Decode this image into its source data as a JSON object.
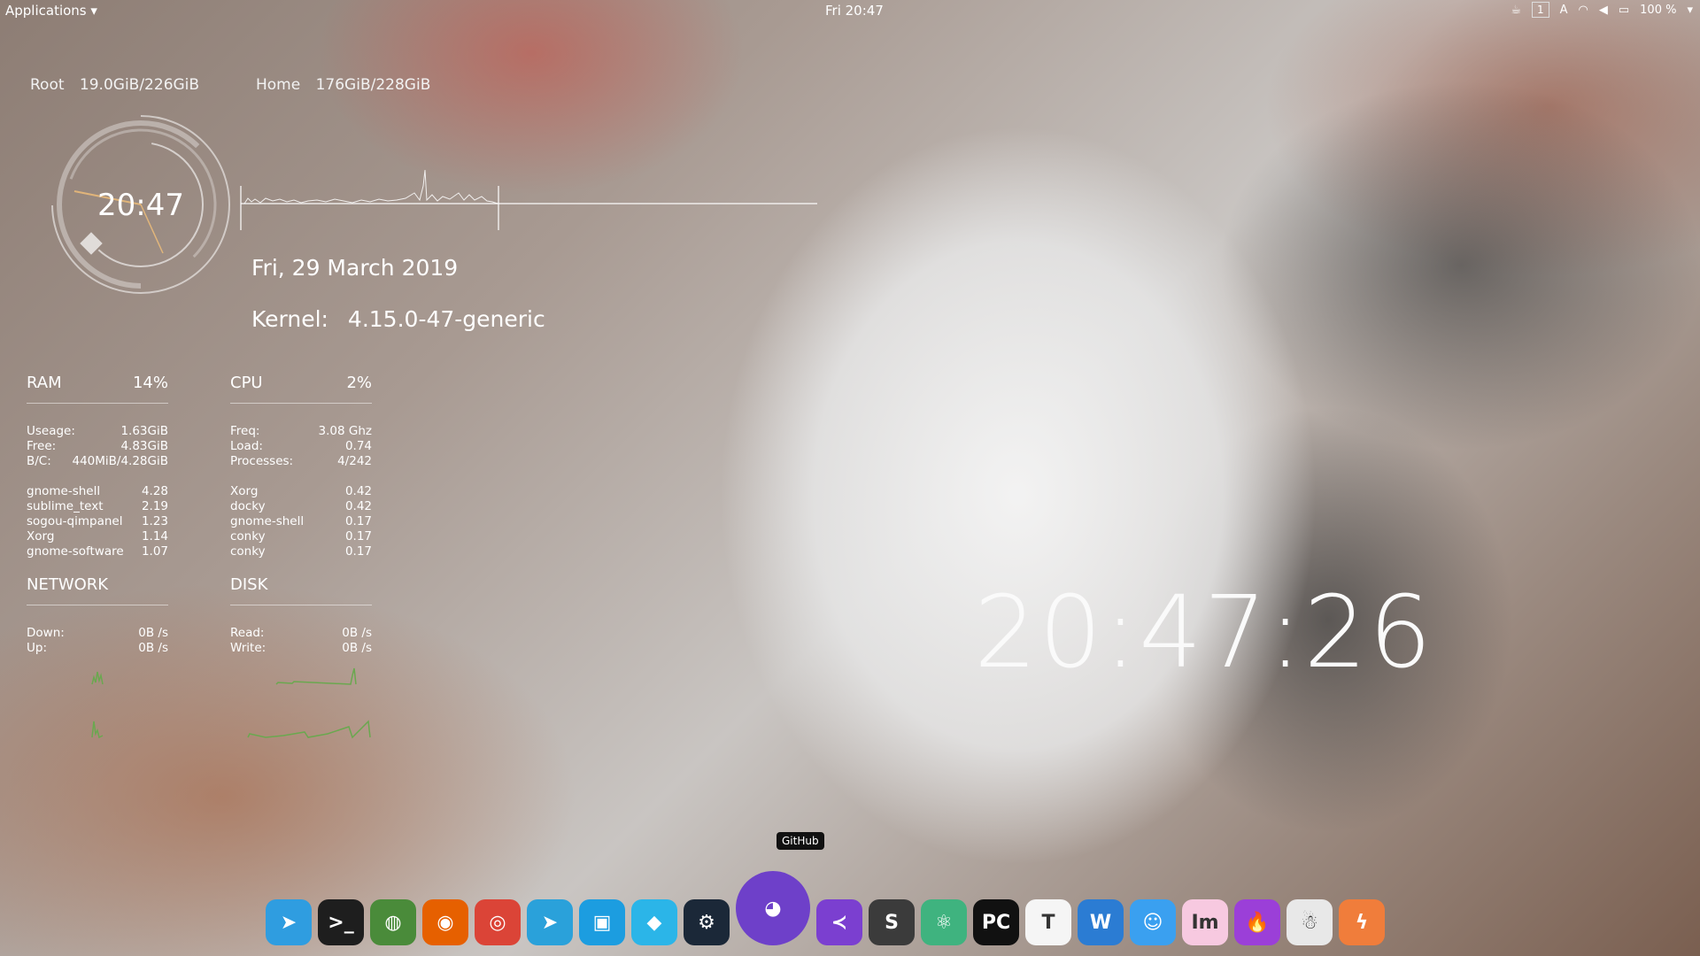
{
  "topbar": {
    "applications_label": "Applications",
    "clock": "Fri 20:47",
    "workspace": "1",
    "battery": "100 %"
  },
  "conky": {
    "root_label": "Root",
    "root_value": "19.0GiB/226GiB",
    "home_label": "Home",
    "home_value": "176GiB/228GiB",
    "ring_time": "20:47",
    "date": "Fri, 29 March 2019",
    "kernel_label": "Kernel:",
    "kernel_value": "4.15.0-47-generic",
    "ram": {
      "title": "RAM",
      "percent": "14%",
      "rows": [
        {
          "label": "Useage:",
          "value": "1.63GiB"
        },
        {
          "label": "Free:",
          "value": "4.83GiB"
        },
        {
          "label": "B/C:",
          "value": "440MiB/4.28GiB"
        }
      ],
      "processes": [
        {
          "name": "gnome-shell",
          "value": "4.28"
        },
        {
          "name": "sublime_text",
          "value": "2.19"
        },
        {
          "name": "sogou-qimpanel",
          "value": "1.23"
        },
        {
          "name": "Xorg",
          "value": "1.14"
        },
        {
          "name": "gnome-software",
          "value": "1.07"
        }
      ]
    },
    "cpu": {
      "title": "CPU",
      "percent": "2%",
      "rows": [
        {
          "label": "Freq:",
          "value": "3.08 Ghz"
        },
        {
          "label": "Load:",
          "value": "0.74"
        },
        {
          "label": "Processes:",
          "value": "4/242"
        }
      ],
      "processes": [
        {
          "name": "Xorg",
          "value": "0.42"
        },
        {
          "name": "docky",
          "value": "0.42"
        },
        {
          "name": "gnome-shell",
          "value": "0.17"
        },
        {
          "name": "conky",
          "value": "0.17"
        },
        {
          "name": "conky",
          "value": "0.17"
        }
      ]
    },
    "network": {
      "title": "NETWORK",
      "rows": [
        {
          "label": "Down:",
          "value": "0B  /s"
        },
        {
          "label": "Up:",
          "value": "0B  /s"
        }
      ]
    },
    "disk": {
      "title": "DISK",
      "rows": [
        {
          "label": "Read:",
          "value": "0B  /s"
        },
        {
          "label": "Write:",
          "value": "0B  /s"
        }
      ]
    },
    "big_clock": "20:47:26"
  },
  "dock": {
    "tooltip": "GitHub",
    "items": [
      {
        "name": "telegram-paper-plane",
        "glyph": "➤",
        "color": "#2f9de0"
      },
      {
        "name": "terminal",
        "glyph": ">_",
        "color": "#1e1e1e"
      },
      {
        "name": "globe",
        "glyph": "◍",
        "color": "#4a8b3a"
      },
      {
        "name": "firefox",
        "glyph": "◉",
        "color": "#e66000"
      },
      {
        "name": "chrome",
        "glyph": "◎",
        "color": "#db4437"
      },
      {
        "name": "telegram",
        "glyph": "➤",
        "color": "#2aa1da"
      },
      {
        "name": "virtualbox",
        "glyph": "▣",
        "color": "#1c9de0"
      },
      {
        "name": "box",
        "glyph": "◆",
        "color": "#2bb5e8"
      },
      {
        "name": "steam",
        "glyph": "⚙",
        "color": "#1b2838"
      },
      {
        "name": "github",
        "glyph": "◕",
        "color": "#6e40c9"
      },
      {
        "name": "vscode",
        "glyph": "≺",
        "color": "#7b3fd0"
      },
      {
        "name": "sublime",
        "glyph": "S",
        "color": "#3b3b3b"
      },
      {
        "name": "atom",
        "glyph": "⚛",
        "color": "#3fb37f"
      },
      {
        "name": "pycharm",
        "glyph": "PC",
        "color": "#111111"
      },
      {
        "name": "typora",
        "glyph": "T",
        "color": "#f5f5f5"
      },
      {
        "name": "wps",
        "glyph": "W",
        "color": "#2b7cd3"
      },
      {
        "name": "finder",
        "glyph": "☺",
        "color": "#3aa0f0"
      },
      {
        "name": "im",
        "glyph": "Im",
        "color": "#f7c9e0"
      },
      {
        "name": "flame",
        "glyph": "🔥",
        "color": "#9b3fd8"
      },
      {
        "name": "ghost",
        "glyph": "☃",
        "color": "#e8e8e8"
      },
      {
        "name": "bolt",
        "glyph": "ϟ",
        "color": "#f07d3b"
      }
    ]
  }
}
